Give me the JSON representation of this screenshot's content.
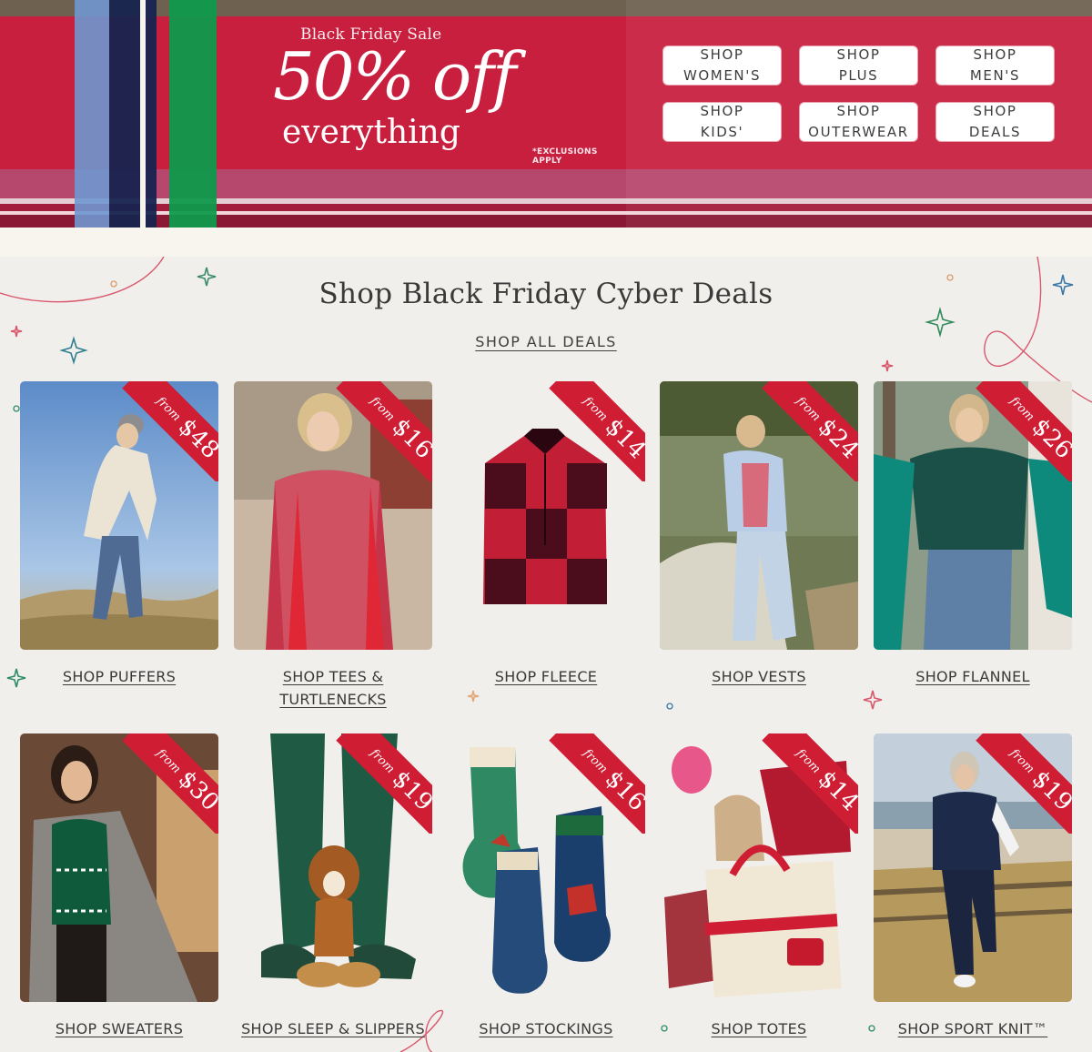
{
  "hero": {
    "sale_label": "Black Friday Sale",
    "headline": "50% off",
    "subheadline": "everything",
    "disclaimer": "*EXCLUSIONS APPLY",
    "buttons": [
      {
        "label": "SHOP\nWOMEN'S"
      },
      {
        "label": "SHOP\nPLUS"
      },
      {
        "label": "SHOP\nMEN'S"
      },
      {
        "label": "SHOP\nKIDS'"
      },
      {
        "label": "SHOP\nOUTERWEAR"
      },
      {
        "label": "SHOP\nDEALS"
      }
    ]
  },
  "deals": {
    "title": "Shop Black Friday Cyber Deals",
    "shop_all": "SHOP ALL DEALS",
    "cards": [
      {
        "label": "SHOP PUFFERS",
        "from": "from",
        "price": "$48",
        "image": "puffer-jacket-photo"
      },
      {
        "label": "SHOP TEES &\nTURTLENECKS",
        "from": "from",
        "price": "$16",
        "image": "plaid-turtleneck-photo"
      },
      {
        "label": "SHOP FLEECE",
        "from": "from",
        "price": "$14",
        "image": "buffalo-check-fleece-photo"
      },
      {
        "label": "SHOP VESTS",
        "from": "from",
        "price": "$24",
        "image": "puffer-vest-photo"
      },
      {
        "label": "SHOP FLANNEL",
        "from": "from",
        "price": "$26",
        "image": "flannel-shirt-photo"
      },
      {
        "label": "SHOP SWEATERS",
        "from": "from",
        "price": "$30",
        "image": "fair-isle-sweater-photo"
      },
      {
        "label": "SHOP SLEEP & SLIPPERS",
        "from": "from",
        "price": "$19",
        "image": "slippers-puppy-photo"
      },
      {
        "label": "SHOP STOCKINGS",
        "from": "from",
        "price": "$16",
        "image": "needlepoint-stockings-photo"
      },
      {
        "label": "SHOP TOTES",
        "from": "from",
        "price": "$14",
        "image": "tote-bag-photo"
      },
      {
        "label": "SHOP SPORT KNIT™",
        "from": "from",
        "price": "$19",
        "image": "sport-knit-photo"
      }
    ]
  },
  "colors": {
    "banner_red": "#c41f3d",
    "ribbon_red": "#cf1d34",
    "plaid_green": "#0f9a4c",
    "plaid_navy": "#1c2a56",
    "page_bg": "#f1efec"
  }
}
